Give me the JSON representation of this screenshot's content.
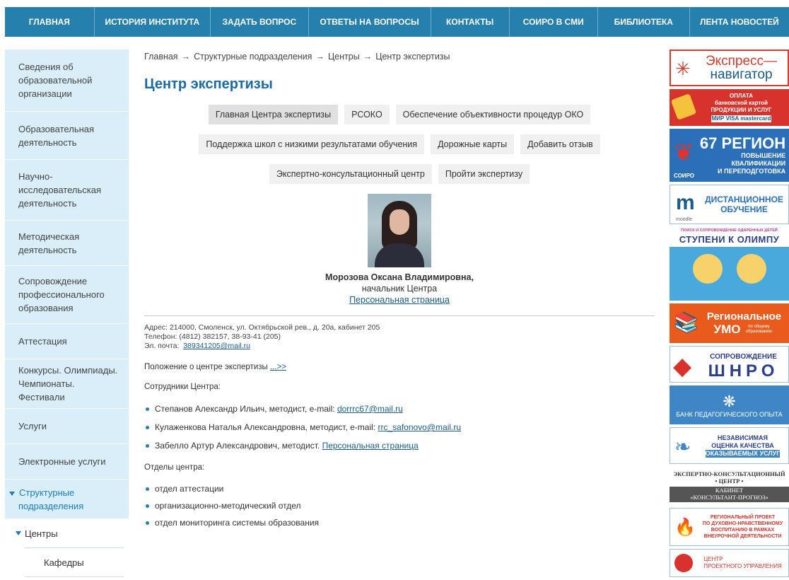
{
  "nav": [
    "ГЛАВНАЯ",
    "ИСТОРИЯ ИНСТИТУТА",
    "ЗАДАТЬ ВОПРОС",
    "ОТВЕТЫ НА ВОПРОСЫ",
    "КОНТАКТЫ",
    "СОИРО В СМИ",
    "БИБЛИОТЕКА",
    "ЛЕНТА НОВОСТЕЙ"
  ],
  "sidebar": {
    "items": [
      "Сведения об образовательной организации",
      "Образовательная деятельность",
      "Научно-исследовательская деятельность",
      "Методическая деятельность",
      "Сопровождение профессионального образования",
      "Аттестация",
      "Конкурсы. Олимпиады. Чемпионаты. Фестивали",
      "Услуги",
      "Электронные услуги",
      "Структурные подразделения"
    ],
    "sub": {
      "centers": "Центры",
      "departments": "Кафедры"
    }
  },
  "breadcrumb": {
    "items": [
      "Главная",
      "Структурные подразделения",
      "Центры",
      "Центр экспертизы"
    ],
    "separator": "→"
  },
  "title": "Центр экспертизы",
  "tabs": {
    "row1": [
      "Главная Центра экспертизы",
      "РСОКО",
      "Обеспечение объективности процедур ОКО"
    ],
    "row2": [
      "Поддержка школ с низкими результатами обучения",
      "Дорожные карты",
      "Добавить отзыв"
    ],
    "row3": [
      "Экспертно-консультационный центр",
      "Пройти экспертизу"
    ]
  },
  "person": {
    "name": "Морозова Оксана Владимировна,",
    "role": "начальник Центра",
    "link": "Персональная страница"
  },
  "contacts": {
    "address": "Адрес: 214000, Смоленск, ул. Октябрьской рев., д. 20а, кабинет 205",
    "phone": "Телефон: (4812) 382157, 38-93-41 (205)",
    "email_label": "Эл. почта:",
    "email": "389341205@mail.ru"
  },
  "regulation": {
    "text": "Положение о центре экспертизы",
    "link": "...>>"
  },
  "staff": {
    "heading": "Сотрудники Центра:",
    "items": [
      {
        "text": "Степанов Александр Ильич, методист, e-mail:",
        "link": "dorrrc67@mail.ru"
      },
      {
        "text": "Кулаженкова Наталья Александровна, методист, e-mail:",
        "link": "rrc_safonovo@mail.ru"
      },
      {
        "text": "Забелло Артур Александрович, методист.",
        "link": "Персональная страница"
      }
    ]
  },
  "departments": {
    "heading": "Отделы центра:",
    "items": [
      "отдел аттестации",
      "организационно-методический отдел",
      "отдел мониторинга системы образования"
    ]
  },
  "banners": {
    "express": [
      "Экспресс—",
      "навигатор"
    ],
    "payment": [
      "ОПЛАТА",
      "банковской картой",
      "ПРОДУКЦИИ И УСЛУГ",
      "МИР VISA mastercard"
    ],
    "region": [
      "67 РЕГИОН",
      "ПОВЫШЕНИЕ",
      "КВАЛИФИКАЦИИ",
      "И ПЕРЕПОДГОТОВКА",
      "СОИРО"
    ],
    "moodle": [
      "ДИСТАНЦИОННОЕ",
      "ОБУЧЕНИЕ",
      "moodle"
    ],
    "olympiad": [
      "ПОИСК И СОПРОВОЖДЕНИЕ ОДАРЕННЫХ ДЕТЕЙ",
      "СТУПЕНИ К ОЛИМПУ"
    ],
    "umo": [
      "Региональное",
      "УМО",
      "по общему образованию"
    ],
    "shnro": [
      "СОПРОВОЖДЕНИЕ",
      "ШНРО"
    ],
    "bank": [
      "БАНК ПЕДАГОГИЧЕСКОГО ОПЫТА"
    ],
    "quality": [
      "НЕЗАВИСИМАЯ",
      "ОЦЕНКА КАЧЕСТВА",
      "ОКАЗЫВАЕМЫХ УСЛУГ"
    ],
    "consult": [
      "ЭКСПЕРТНО-КОНСУЛЬТАЦИОННЫЙ",
      "• ЦЕНТР •",
      "КАБИНЕТ",
      "«КОНСУЛЬТАНТ-ПРОГНОЗ»"
    ],
    "spiritual": [
      "РЕГИОНАЛЬНЫЙ ПРОЕКТ",
      "ПО ДУХОВНО-НРАВСТВЕННОМУ",
      "ВОСПИТАНИЮ В РАМКАХ",
      "ВНЕУРОЧНОЙ ДЕЯТЕЛЬНОСТИ"
    ],
    "project": [
      "ЦЕНТР",
      "ПРОЕКТНОГО УПРАВЛЕНИЯ"
    ]
  }
}
